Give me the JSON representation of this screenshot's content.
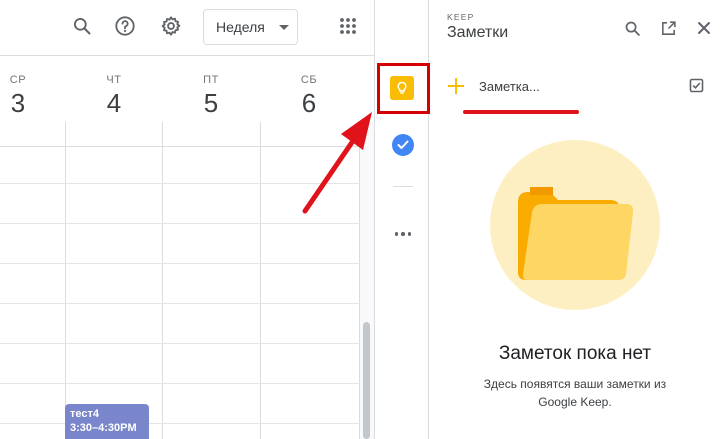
{
  "header": {
    "view_select_label": "Неделя"
  },
  "days": [
    {
      "name": "СР",
      "num": "3"
    },
    {
      "name": "ЧТ",
      "num": "4"
    },
    {
      "name": "ПТ",
      "num": "5"
    },
    {
      "name": "СБ",
      "num": "6"
    }
  ],
  "event": {
    "title": "тест4",
    "time": "3:30–4:30PM",
    "color": "#7986cb"
  },
  "keep": {
    "brand": "KEEP",
    "title": "Заметки",
    "new_note_label": "Заметка...",
    "empty_title": "Заметок пока нет",
    "empty_desc_line1": "Здесь появятся ваши заметки из",
    "empty_desc_line2": "Google Keep.",
    "accent_color": "#fbbc04"
  },
  "icons": [
    "search-icon",
    "help-icon",
    "gear-icon",
    "apps-grid-icon",
    "avatar",
    "keep-icon",
    "tasks-icon",
    "more-icon",
    "open-in-new-icon",
    "close-icon",
    "checkbox-icon",
    "folder-icon"
  ],
  "annotation_color": "#e0121a"
}
